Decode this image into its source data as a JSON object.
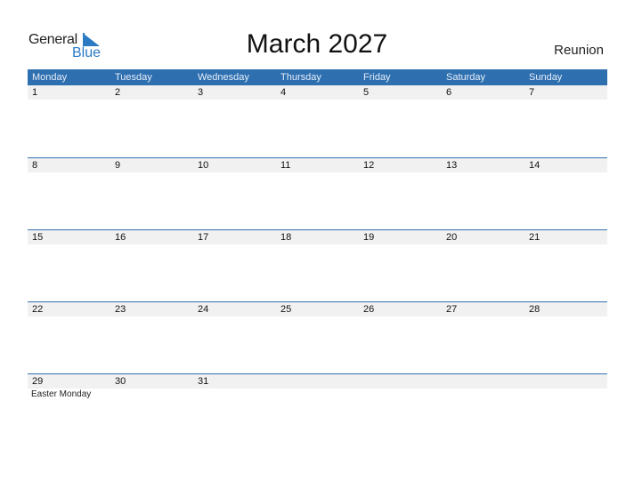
{
  "logo": {
    "general": "General",
    "blue": "Blue"
  },
  "title": "March 2027",
  "country": "Reunion",
  "days": [
    "Monday",
    "Tuesday",
    "Wednesday",
    "Thursday",
    "Friday",
    "Saturday",
    "Sunday"
  ],
  "weeks": [
    {
      "dates": [
        "1",
        "2",
        "3",
        "4",
        "5",
        "6",
        "7"
      ],
      "notes": [
        "",
        "",
        "",
        "",
        "",
        "",
        ""
      ]
    },
    {
      "dates": [
        "8",
        "9",
        "10",
        "11",
        "12",
        "13",
        "14"
      ],
      "notes": [
        "",
        "",
        "",
        "",
        "",
        "",
        ""
      ]
    },
    {
      "dates": [
        "15",
        "16",
        "17",
        "18",
        "19",
        "20",
        "21"
      ],
      "notes": [
        "",
        "",
        "",
        "",
        "",
        "",
        ""
      ]
    },
    {
      "dates": [
        "22",
        "23",
        "24",
        "25",
        "26",
        "27",
        "28"
      ],
      "notes": [
        "",
        "",
        "",
        "",
        "",
        "",
        ""
      ]
    },
    {
      "dates": [
        "29",
        "30",
        "31",
        "",
        "",
        "",
        ""
      ],
      "notes": [
        "Easter Monday",
        "",
        "",
        "",
        "",
        "",
        ""
      ]
    }
  ],
  "colors": {
    "header": "#2e6fb0",
    "accent": "#2a7bc4",
    "band": "#f1f1f1"
  }
}
